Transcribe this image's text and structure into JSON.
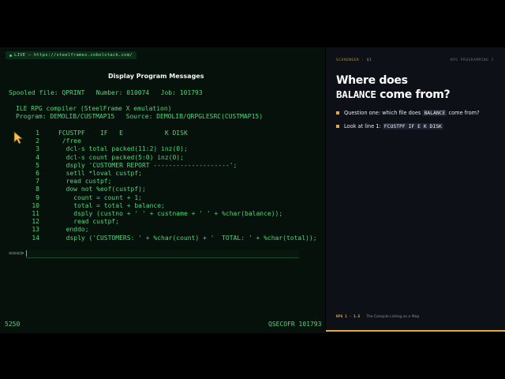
{
  "terminal": {
    "live_badge": "LIVE — https://steelframex.cobolstack.com/",
    "screen_title": "Display Program Messages",
    "spooled_line": "Spooled file: QPRINT   Number: 010074   Job: 101793",
    "compiler_line": "ILE RPG compiler (SteelFrame X emulation)",
    "program_line": "Program: DEMOLIB/CUSTMAP15   Source: DEMOLIB/QRPGLESRC(CUSTMAP15)",
    "code_lines": [
      {
        "num": "1",
        "text": "FCUSTPF    IF   E           K DISK"
      },
      {
        "num": "2",
        "text": " /free"
      },
      {
        "num": "3",
        "text": "  dcl-s total packed(11:2) inz(0);"
      },
      {
        "num": "4",
        "text": "  dcl-s count packed(5:0) inz(0);"
      },
      {
        "num": "5",
        "text": "  dsply 'CUSTOMER REPORT --------------------';"
      },
      {
        "num": "6",
        "text": "  setll *loval custpf;"
      },
      {
        "num": "7",
        "text": "  read custpf;"
      },
      {
        "num": "8",
        "text": "  dow not %eof(custpf);"
      },
      {
        "num": "9",
        "text": "    count = count + 1;"
      },
      {
        "num": "10",
        "text": "    total = total + balance;"
      },
      {
        "num": "11",
        "text": "    dsply (custno + ' ' + custname + ' ' + %char(balance));"
      },
      {
        "num": "12",
        "text": "    read custpf;"
      },
      {
        "num": "13",
        "text": "  enddo;"
      },
      {
        "num": "14",
        "text": "  dsply ('CUSTOMERS: ' + %char(count) + '  TOTAL: ' + %char(total));"
      }
    ],
    "prompt": "===>",
    "status_left": "5250",
    "status_right": "QSECOFR 101793"
  },
  "panel": {
    "topbar_left": "SCAVENGER · Q1",
    "topbar_right": "RPG PROGRAMMING I",
    "heading_part1": "Where does",
    "heading_code": "BALANCE",
    "heading_part2": "come from?",
    "bullet1_prefix": "Question one: which file does",
    "bullet1_code": "BALANCE",
    "bullet1_suffix": "come from?",
    "bullet2_prefix": "Look at line 1:",
    "bullet2_code": "FCUSTPF IF E K DISK",
    "footer_tag": "RPG 1 · 1.5",
    "footer_text": "The Compile Listing as a Map",
    "accent": "#e0a94a"
  }
}
